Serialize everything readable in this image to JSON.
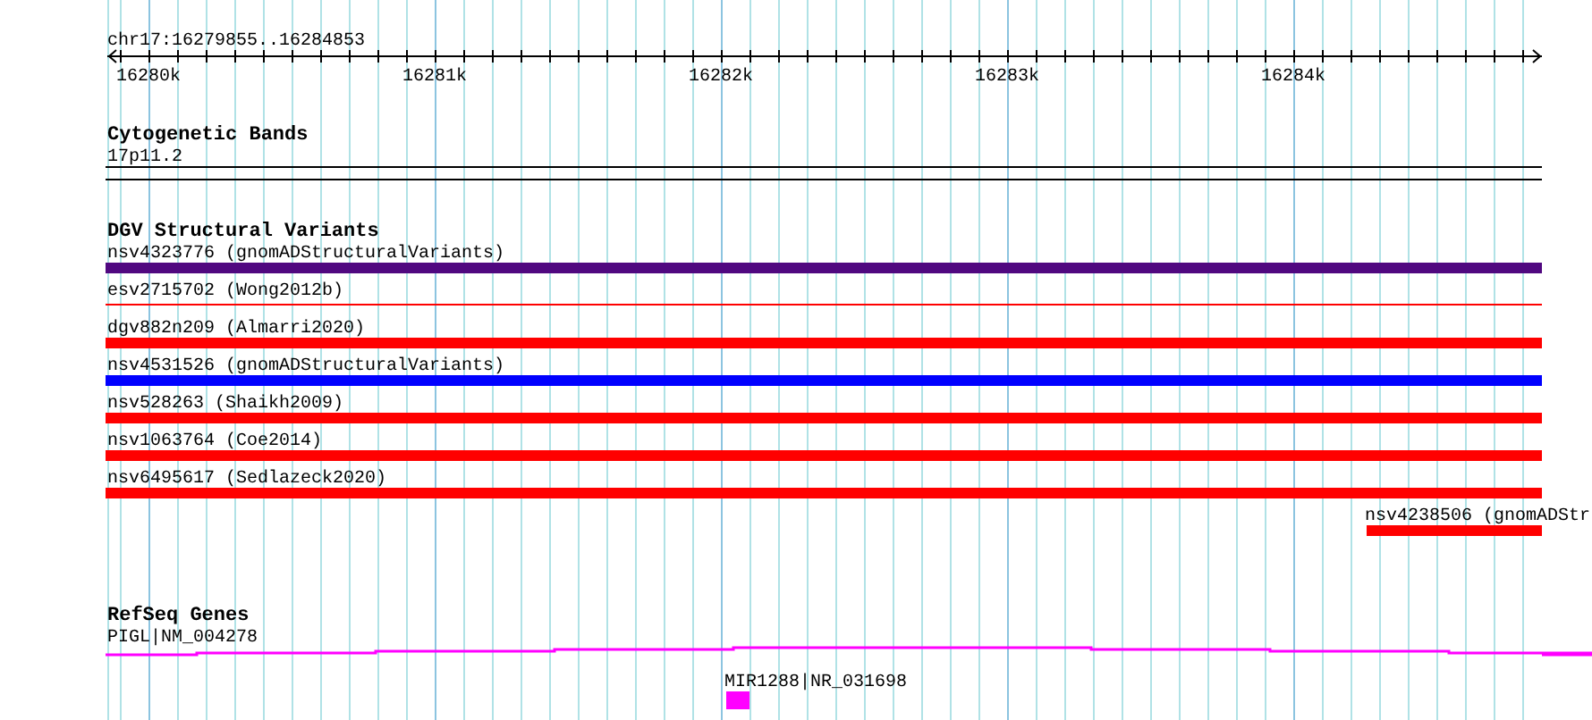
{
  "ruler": {
    "title": "chr17:16279855..16284853",
    "ticks": [
      "16280k",
      "16281k",
      "16282k",
      "16283k",
      "16284k"
    ]
  },
  "tracks": [
    {
      "title": "Cytogenetic Bands",
      "features": [
        {
          "label": "17p11.2",
          "kind": "band"
        }
      ]
    },
    {
      "title": "DGV Structural Variants",
      "features": [
        {
          "label": "nsv4323776 (gnomADStructuralVariants)",
          "kind": "thick",
          "color": "#500880"
        },
        {
          "label": "esv2715702 (Wong2012b)",
          "kind": "thin",
          "color": "#ff0000"
        },
        {
          "label": "dgv882n209 (Almarri2020)",
          "kind": "thick",
          "color": "#ff0000"
        },
        {
          "label": "nsv4531526 (gnomADStructuralVariants)",
          "kind": "thick",
          "color": "#0000ff"
        },
        {
          "label": "nsv528263 (Shaikh2009)",
          "kind": "thick",
          "color": "#ff0000"
        },
        {
          "label": "nsv1063764 (Coe2014)",
          "kind": "thick",
          "color": "#ff0000"
        },
        {
          "label": "nsv6495617 (Sedlazeck2020)",
          "kind": "thick",
          "color": "#ff0000"
        },
        {
          "label": "nsv4238506 (gnomADStr",
          "kind": "thick",
          "color": "#ff0000"
        }
      ]
    },
    {
      "title": "RefSeq Genes",
      "features": [
        {
          "label": "PIGL|NM_004278",
          "kind": "gene"
        },
        {
          "label": "MIR1288|NR_031698",
          "kind": "mirna"
        }
      ]
    }
  ]
}
